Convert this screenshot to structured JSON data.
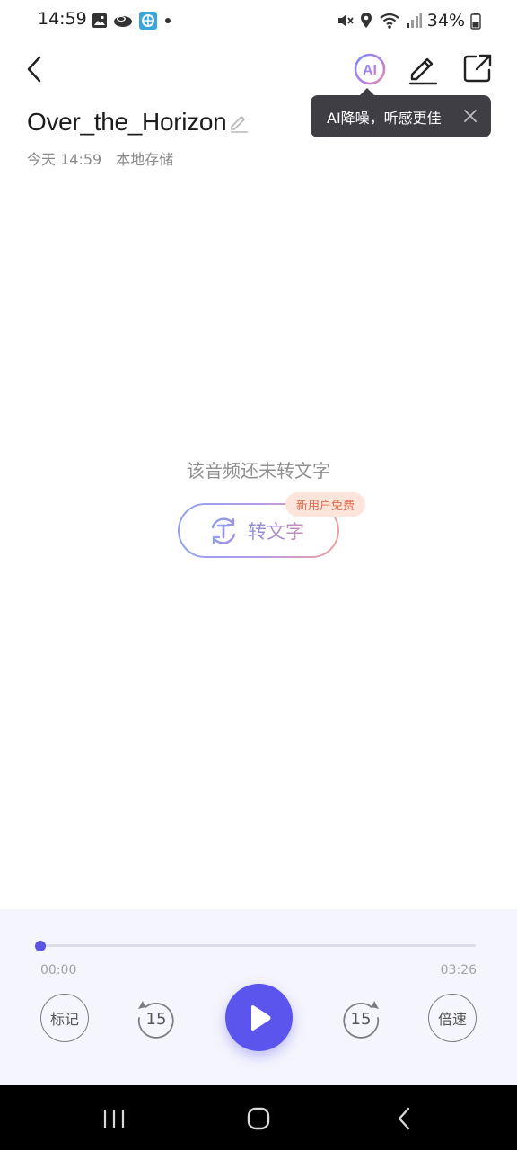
{
  "status_bar": {
    "time": "14:59",
    "battery": "34%",
    "left_icons": [
      "image-icon",
      "cloud-icon",
      "app-icon",
      "dot-icon"
    ],
    "right_icons": [
      "mute-icon",
      "location-icon",
      "wifi-icon",
      "signal-icon",
      "battery-icon"
    ]
  },
  "header": {
    "ai_label": "AI",
    "icons": [
      "back-icon",
      "ai-icon",
      "edit-icon",
      "share-icon"
    ]
  },
  "recording": {
    "title": "Over_the_Horizon",
    "date": "今天 14:59",
    "storage": "本地存储"
  },
  "tooltip": {
    "text": "AI降噪，听感更佳"
  },
  "transcription": {
    "empty_text": "该音频还未转文字",
    "button_label": "转文字",
    "badge": "新用户免费"
  },
  "player": {
    "current_time": "00:00",
    "total_time": "03:26",
    "progress": 0,
    "mark_label": "标记",
    "rewind_seconds": "15",
    "forward_seconds": "15",
    "speed_label": "倍速"
  },
  "colors": {
    "accent": "#5b55ed",
    "tooltip_bg": "#3e3e44",
    "badge_bg": "#fde5dc",
    "badge_text": "#e26a48",
    "player_bg": "#f5f5fd"
  }
}
